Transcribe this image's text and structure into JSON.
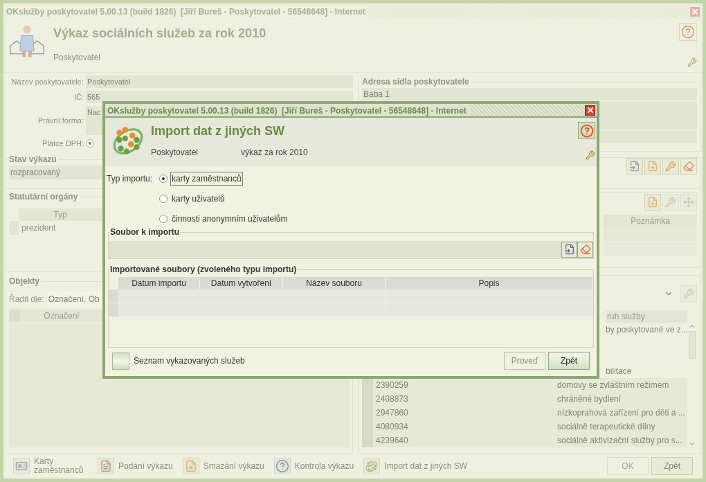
{
  "window": {
    "title": "OKslužby poskytovatel 5.00.13 (build 1826)  [Jiří Bureš - Poskytovatel - 56548648] - Internet"
  },
  "header": {
    "title": "Výkaz sociálních služeb za rok 2010",
    "subtitle": "Poskytovatel"
  },
  "provider_form": {
    "fields": [
      {
        "label": "Název poskytovatele:",
        "value": "Poskytovatel"
      },
      {
        "label": "IČ:",
        "value": "565"
      },
      {
        "label": "Právní forma:",
        "value": "Nac"
      }
    ],
    "vat_payer": {
      "label": "Plátce DPH:",
      "checked": true
    }
  },
  "address": {
    "title": "Adresa sídla poskytovatele",
    "line_1": "Baba 1"
  },
  "report_status": {
    "title": "Stav výkazu",
    "value": "rozpracovaný"
  },
  "statutory_bodies": {
    "title": "Statutární orgány",
    "columns": [
      "Typ",
      "Poznámka"
    ],
    "rows": [
      {
        "type": "prezident"
      }
    ]
  },
  "objects": {
    "title": "Objekty",
    "sort_label": "Řadit dle:",
    "sort_value": "Označení, Ob",
    "columns": [
      "Označení",
      "ruh služby"
    ],
    "rows": [
      {
        "service": "by poskytované ve z..."
      },
      {},
      {},
      {
        "service": "bilitace"
      },
      {
        "id": "2390259",
        "service": "domovy se zvláštním režimem"
      },
      {
        "id": "2408873",
        "service": "chráněné bydlení"
      },
      {
        "id": "2947860",
        "service": "nízkoprahová zařízení pro děti a ..."
      },
      {
        "id": "4080934",
        "service": "sociálně terapeutické dílny"
      },
      {
        "id": "4239640",
        "service": "sociálně aktivizační služby pro s..."
      }
    ]
  },
  "toolbar": [
    {
      "kind": "cards",
      "label": "Karty zaměstnanců"
    },
    {
      "kind": "submit",
      "label": "Podání výkazu"
    },
    {
      "kind": "delete",
      "label": "Smazání výkazu"
    },
    {
      "kind": "check",
      "label": "Kontrola výkazu"
    },
    {
      "kind": "import",
      "label": "Import dat z jiných SW"
    }
  ],
  "buttons": [
    {
      "label": "OK",
      "disabled": true
    },
    {
      "label": "Zpět",
      "disabled": false
    }
  ],
  "dialog": {
    "title": "OKslužby poskytovatel 5.00.13 (build 1826)  [Jiří Bureš - Poskytovatel - 56548648] - Internet",
    "heading": "Import dat z jiných SW",
    "provider": "Poskytovatel",
    "report": "výkaz za rok 2010",
    "import_type": {
      "label": "Typ importu:",
      "options": [
        {
          "label": "karty zaměstnanců",
          "selected": true
        },
        {
          "label": "karty uživatelů",
          "selected": false
        },
        {
          "label": "činnosti anonymním uživatelům",
          "selected": false
        }
      ]
    },
    "file_section": {
      "title": "Soubor k importu"
    },
    "imported_files": {
      "title": "Importované soubory (zvoleného typu importu)",
      "columns": [
        "Datum importu",
        "Datum vytvoření",
        "Název souboru",
        "Popis"
      ]
    },
    "list_button": {
      "label": "Seznam vykazovaných služeb"
    },
    "buttons": [
      {
        "label": "Proveď",
        "disabled": true
      },
      {
        "label": "Zpět",
        "disabled": false
      }
    ]
  }
}
